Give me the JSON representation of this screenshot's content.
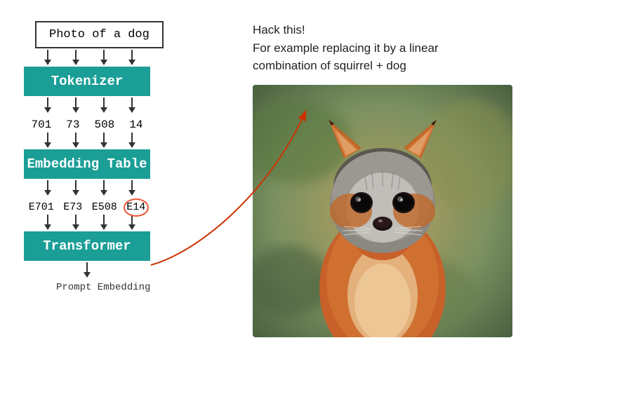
{
  "diagram": {
    "input_label": "Photo of a dog",
    "tokenizer_label": "Tokenizer",
    "tokens": [
      "701",
      "73",
      "508",
      "14"
    ],
    "embedding_table_label": "Embedding Table",
    "embeddings": [
      "E701",
      "E73",
      "E508",
      "E14"
    ],
    "transformer_label": "Transformer",
    "output_label": "Prompt Embedding"
  },
  "right_panel": {
    "hack_text_line1": "Hack this!",
    "hack_text_line2": "For example replacing it by a linear",
    "hack_text_line3": "combination of squirrel + dog"
  },
  "colors": {
    "teal": "#1a9e96",
    "red_arrow": "#cc3300",
    "box_border": "#333333"
  }
}
